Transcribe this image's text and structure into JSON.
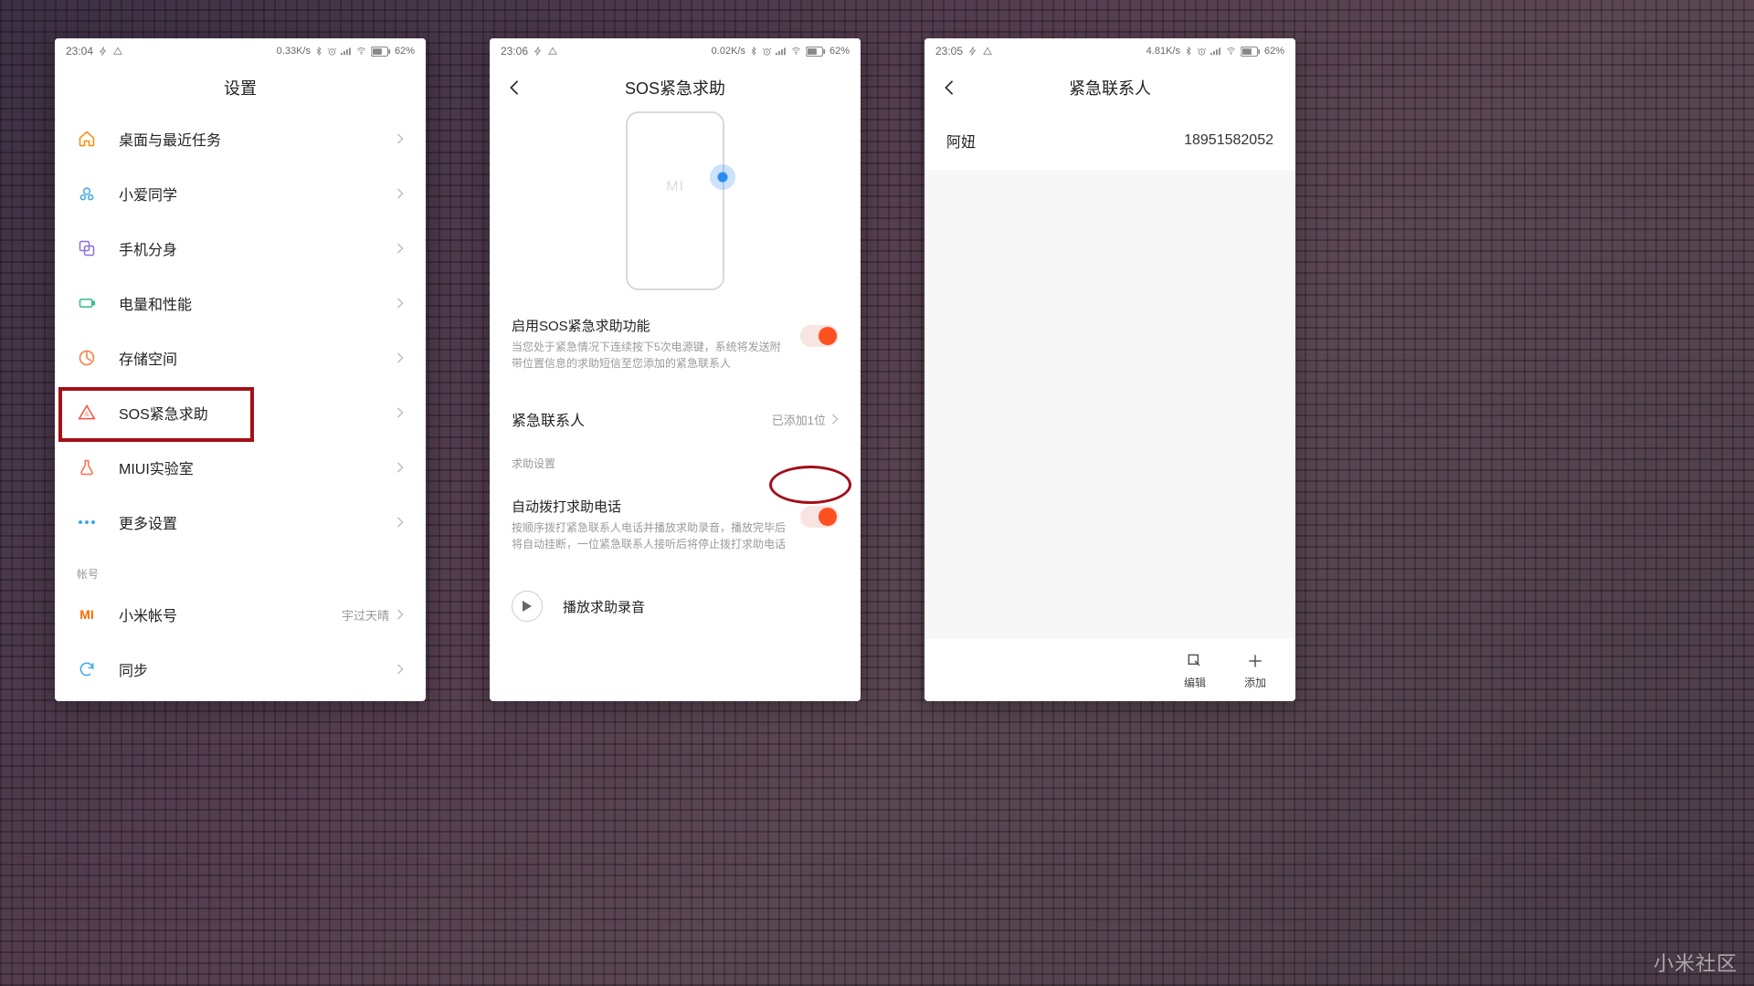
{
  "watermark": "小米社区",
  "phones": {
    "left": {
      "status": {
        "time": "23:04",
        "speed": "0.33K/s",
        "battery": "62%"
      },
      "title": "设置",
      "items": [
        {
          "icon": "home",
          "label": "桌面与最近任务",
          "color": "#ff8a00"
        },
        {
          "icon": "ai",
          "label": "小爱同学",
          "color": "#3ba8e8"
        },
        {
          "icon": "dual",
          "label": "手机分身",
          "color": "#8e6ee6"
        },
        {
          "icon": "battery",
          "label": "电量和性能",
          "color": "#2fbd83"
        },
        {
          "icon": "storage",
          "label": "存储空间",
          "color": "#ff7a3c"
        },
        {
          "icon": "sos",
          "label": "SOS紧急求助",
          "color": "#ff4d3c"
        },
        {
          "icon": "lab",
          "label": "MIUI实验室",
          "color": "#ff6b4a"
        },
        {
          "icon": "more",
          "label": "更多设置",
          "color": "#3ba8e8"
        }
      ],
      "section_account": "帐号",
      "account_items": [
        {
          "icon": "mi",
          "label": "小米帐号",
          "value": "宇过天晴",
          "color": "#ff6b00"
        },
        {
          "icon": "sync",
          "label": "同步",
          "value": "",
          "color": "#3ba8e8"
        }
      ]
    },
    "middle": {
      "status": {
        "time": "23:06",
        "speed": "0.02K/s",
        "battery": "62%"
      },
      "title": "SOS紧急求助",
      "mi_logo": "MI",
      "enable": {
        "title": "启用SOS紧急求助功能",
        "desc": "当您处于紧急情况下连续按下5次电源键，系统将发送附带位置信息的求助短信至您添加的紧急联系人"
      },
      "contacts_row": {
        "title": "紧急联系人",
        "value": "已添加1位"
      },
      "section_head": "求助设置",
      "autodial": {
        "title": "自动拨打求助电话",
        "desc": "按顺序拨打紧急联系人电话并播放求助录音，播放完毕后将自动挂断，一位紧急联系人接听后将停止拨打求助电话"
      },
      "play_label": "播放求助录音"
    },
    "right": {
      "status": {
        "time": "23:05",
        "speed": "4.81K/s",
        "battery": "62%"
      },
      "title": "紧急联系人",
      "contact": {
        "name": "阿妞",
        "number": "18951582052"
      },
      "actions": {
        "edit": "编辑",
        "add": "添加"
      }
    }
  }
}
